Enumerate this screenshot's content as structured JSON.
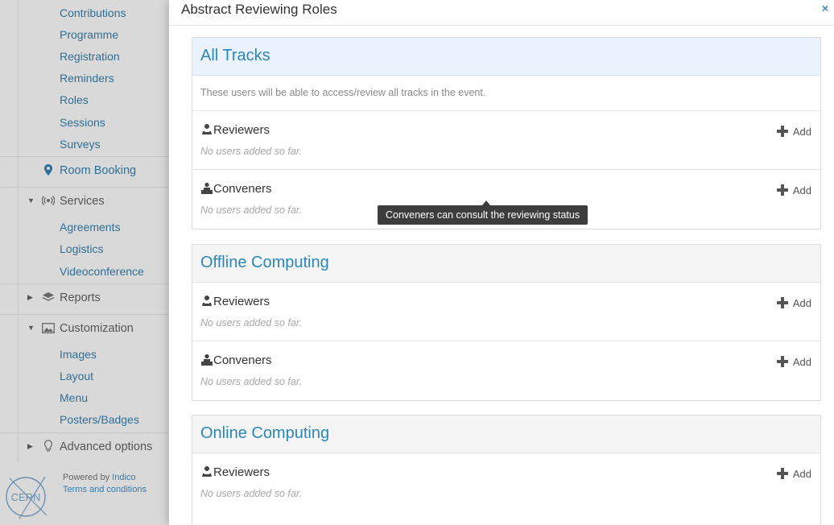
{
  "sidebar": {
    "top_items": [
      "Contributions",
      "Programme",
      "Registration",
      "Reminders",
      "Roles",
      "Sessions",
      "Surveys"
    ],
    "room_booking": {
      "label": "Room Booking",
      "icon": "map-pin-icon"
    },
    "services": {
      "label": "Services",
      "icon": "broadcast-icon",
      "items": [
        "Agreements",
        "Logistics",
        "Videoconference"
      ]
    },
    "reports": {
      "label": "Reports",
      "icon": "layers-icon"
    },
    "customization": {
      "label": "Customization",
      "icon": "image-icon",
      "items": [
        "Images",
        "Layout",
        "Menu",
        "Posters/Badges"
      ]
    },
    "advanced": {
      "label": "Advanced options",
      "icon": "lightbulb-icon"
    },
    "footer": {
      "logo_text": "CERN",
      "powered_by": "Powered by",
      "indico": "Indico",
      "terms": "Terms and conditions"
    }
  },
  "modal": {
    "title": "Abstract Reviewing Roles",
    "close": "×",
    "groups": [
      {
        "title": "All Tracks",
        "description": "These users will be able to access/review all tracks in the event.",
        "roles": [
          {
            "name": "Reviewers",
            "empty": "No users added so far.",
            "add": "Add"
          },
          {
            "name": "Conveners",
            "empty": "No users added so far.",
            "add": "Add"
          }
        ]
      },
      {
        "title": "Offline Computing",
        "roles": [
          {
            "name": "Reviewers",
            "empty": "No users added so far.",
            "add": "Add"
          },
          {
            "name": "Conveners",
            "empty": "No users added so far.",
            "add": "Add"
          }
        ]
      },
      {
        "title": "Online Computing",
        "roles": [
          {
            "name": "Reviewers",
            "empty": "No users added so far.",
            "add": "Add"
          }
        ]
      }
    ],
    "tooltip": "Conveners can consult the reviewing status"
  },
  "colors": {
    "accent": "#2b87b8",
    "link": "#2f6f95",
    "tooltip_bg": "#3d3d3d"
  }
}
